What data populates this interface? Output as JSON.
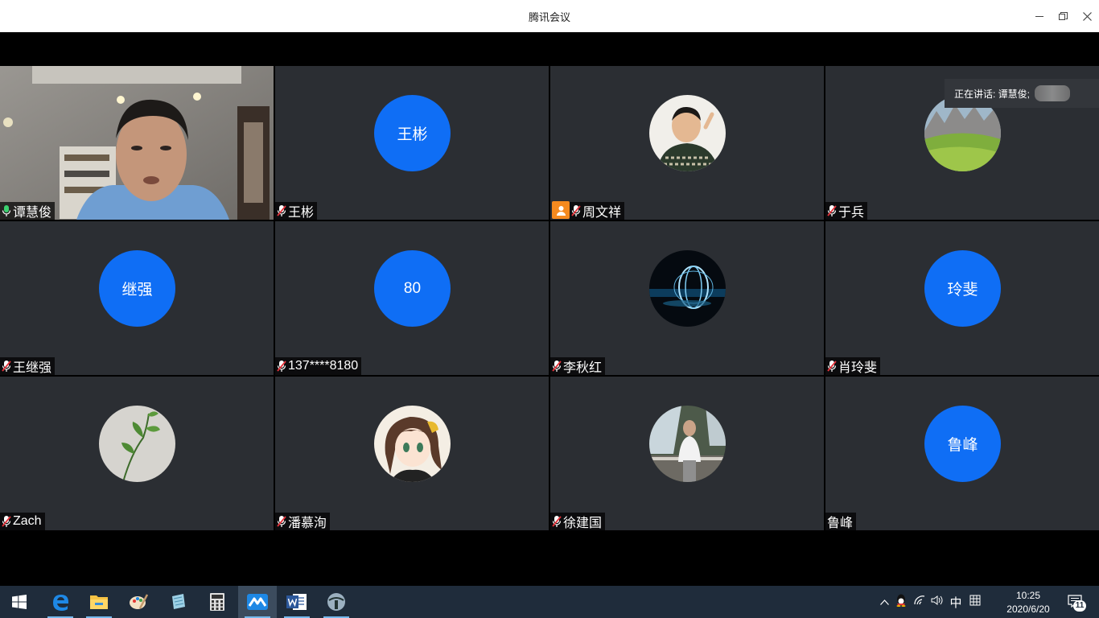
{
  "window": {
    "title": "腾讯会议",
    "minimize": "—",
    "restore": "⧉",
    "close": "✕"
  },
  "speaking": {
    "label": "正在讲话: 谭慧俊;"
  },
  "participants": [
    {
      "name": "谭慧俊",
      "avatar_text": "",
      "avatar_type": "video",
      "mic": "active"
    },
    {
      "name": "王彬",
      "avatar_text": "王彬",
      "avatar_type": "initials",
      "mic": "muted"
    },
    {
      "name": "周文祥",
      "avatar_text": "",
      "avatar_type": "photo-child",
      "mic": "muted",
      "host_badge": true
    },
    {
      "name": "于兵",
      "avatar_text": "",
      "avatar_type": "photo-landscape",
      "mic": "muted"
    },
    {
      "name": "王继强",
      "avatar_text": "继强",
      "avatar_type": "initials",
      "mic": "muted"
    },
    {
      "name": "137****8180",
      "avatar_text": "80",
      "avatar_type": "initials",
      "mic": "muted"
    },
    {
      "name": "李秋红",
      "avatar_text": "",
      "avatar_type": "photo-lightorb",
      "mic": "muted"
    },
    {
      "name": "肖玲斐",
      "avatar_text": "玲斐",
      "avatar_type": "initials",
      "mic": "muted"
    },
    {
      "name": "Zach",
      "avatar_text": "",
      "avatar_type": "photo-plant",
      "mic": "muted"
    },
    {
      "name": "潘慕洵",
      "avatar_text": "",
      "avatar_type": "photo-anime",
      "mic": "muted"
    },
    {
      "name": "徐建国",
      "avatar_text": "",
      "avatar_type": "photo-waterfall",
      "mic": "muted"
    },
    {
      "name": "鲁峰",
      "avatar_text": "鲁峰",
      "avatar_type": "initials",
      "mic": "none"
    }
  ],
  "taskbar": {
    "items": [
      "start-icon",
      "edge-icon",
      "file-explorer-icon",
      "paint-icon",
      "notes-icon",
      "calculator-icon",
      "tencent-meeting-icon",
      "word-icon",
      "app-icon"
    ],
    "tray": {
      "ime": "中",
      "time": "10:25",
      "date": "2020/6/20",
      "notifications": "11"
    }
  },
  "colors": {
    "tile_bg": "#2b2e33",
    "avatar_blue": "#0f6ef5",
    "active_border": "#3bd16f",
    "taskbar": "#1f2c3b"
  }
}
